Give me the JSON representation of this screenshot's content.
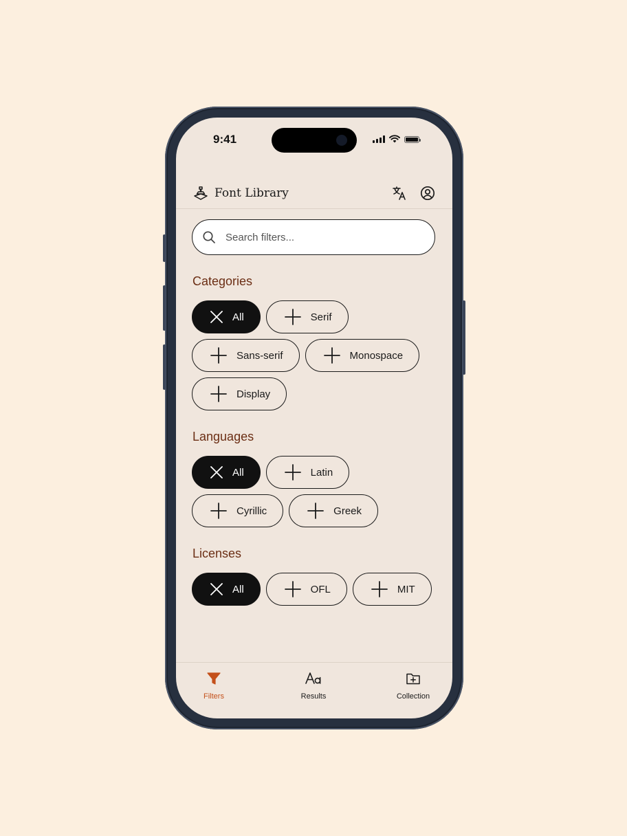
{
  "status": {
    "time": "9:41"
  },
  "app": {
    "title": "Font Library"
  },
  "search": {
    "placeholder": "Search filters..."
  },
  "sections": {
    "categories": {
      "title": "Categories",
      "chips": [
        "All",
        "Serif",
        "Sans-serif",
        "Monospace",
        "Display"
      ]
    },
    "languages": {
      "title": "Languages",
      "chips": [
        "All",
        "Latin",
        "Cyrillic",
        "Greek"
      ]
    },
    "licenses": {
      "title": "Licenses",
      "chips": [
        "All",
        "OFL",
        "MIT"
      ]
    }
  },
  "tabs": {
    "filters": "Filters",
    "results": "Results",
    "collection": "Collection"
  },
  "colors": {
    "background": "#fcefdf",
    "screen": "#f0e6dd",
    "section_title": "#6b2e14",
    "active_tab": "#c4501a",
    "chip_selected": "#111111"
  },
  "icons": {
    "brand": "stamp-logo-icon",
    "translate": "translate-icon",
    "account": "account-circle-icon",
    "search": "search-icon",
    "selected_chip": "close-icon",
    "unselected_chip": "plus-icon",
    "filters_tab": "filter-funnel-icon",
    "results_tab": "font-aa-icon",
    "collection_tab": "folder-plus-icon"
  }
}
